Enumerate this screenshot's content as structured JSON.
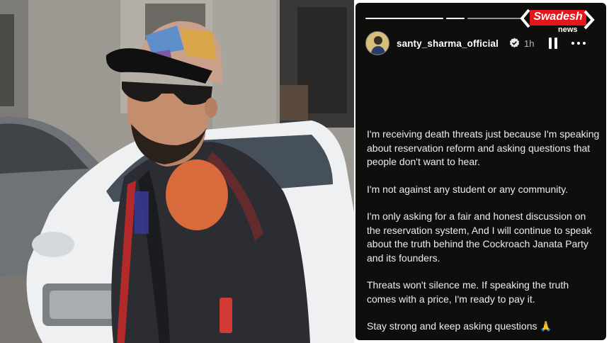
{
  "logo": {
    "word": "Swadesh",
    "sub": "news",
    "colors": {
      "red": "#e4161c",
      "arrow": "#ffffff"
    }
  },
  "story": {
    "background": "#0e0e0c",
    "progress_segments": [
      {
        "active": true
      },
      {
        "active": true
      },
      {
        "active": false
      }
    ],
    "username": "santy_sharma_official",
    "verified": true,
    "time": "1h",
    "paragraphs": [
      "I'm receiving death threats just because I'm speaking about reservation reform and asking questions that people don't want to hear.",
      "I'm not against any student or any community.",
      "I'm only asking for a fair and honest discussion on the reservation system, And I will continue to speak about the truth behind the Cockroach Janata Party and its founders.",
      "Threats won't silence me. If speaking the truth comes with a price, I'm ready to pay it.",
      "Stay strong and keep asking questions 🙏"
    ],
    "icons": {
      "pause": "pause-icon",
      "more": "more-options-icon",
      "verified": "verified-badge-icon"
    }
  },
  "photo": {
    "subject": "man in patterned cap, sunglasses and black jacket standing near white car"
  }
}
